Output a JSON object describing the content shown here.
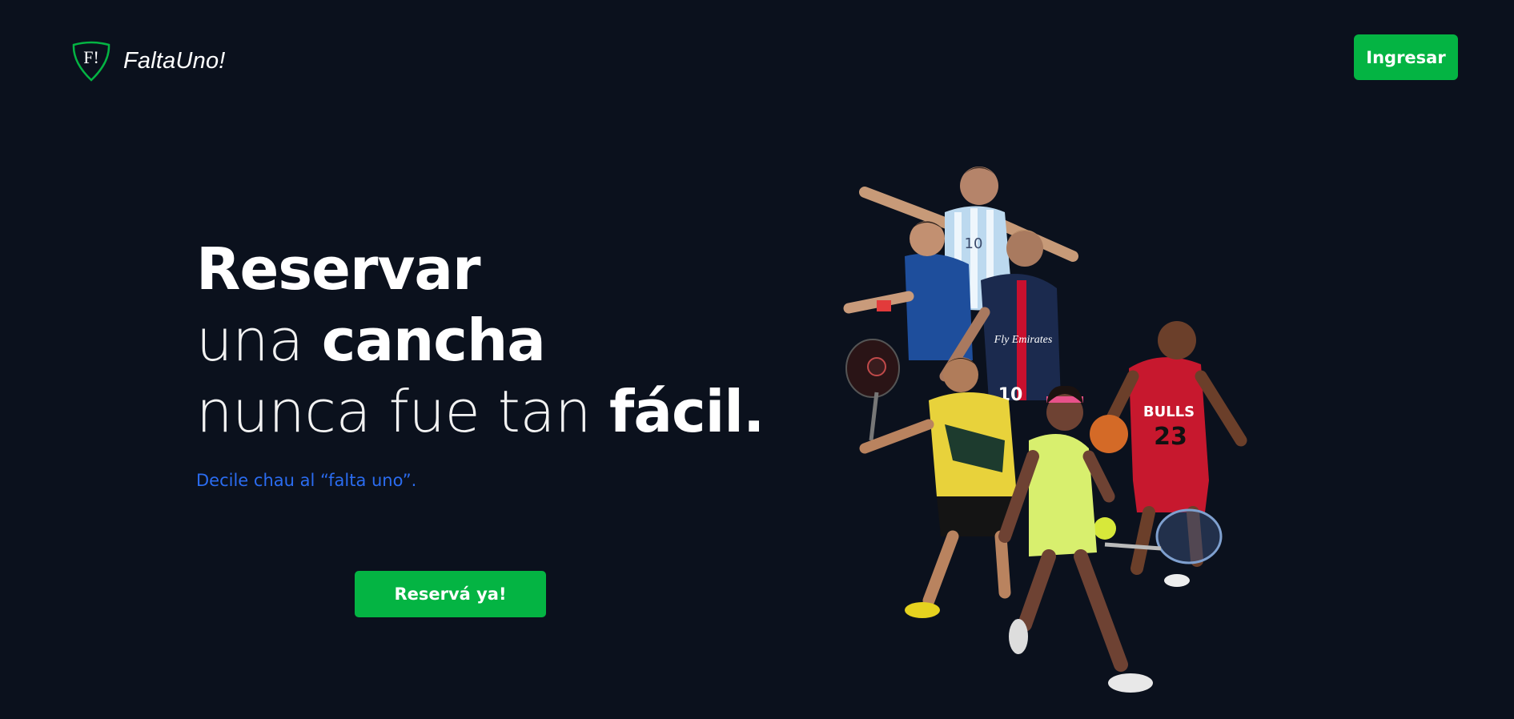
{
  "header": {
    "brand": "FaltaUno!",
    "brand_mark": "F!",
    "login_label": "Ingresar"
  },
  "hero": {
    "line1_bold": "Reservar",
    "line2_thin": "una",
    "line2_bold": "cancha",
    "line3_thin": "nunca fue tan",
    "line3_bold": "fácil.",
    "tagline": "Decile chau al “falta uno”.",
    "cta_label": "Reservá ya!"
  },
  "athletes": {
    "jersey_argentina": "10",
    "jersey_psg": "10",
    "jersey_psg_sponsor": "Fly Emirates",
    "jersey_bulls_team": "BULLS",
    "jersey_bulls_number": "23"
  },
  "colors": {
    "background": "#0b111d",
    "accent_green": "#04b443",
    "tagline_blue": "#2b6cf0",
    "text": "#ffffff"
  }
}
